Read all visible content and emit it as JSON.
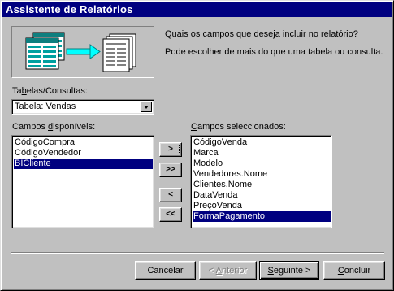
{
  "window": {
    "title": "Assistente de Relatórios"
  },
  "intro": {
    "line1": "Quais os campos que deseja incluir no relatório?",
    "line2": "Pode escolher de mais do que uma tabela ou consulta."
  },
  "tables": {
    "label_pre": "Ta",
    "label_accel": "b",
    "label_post": "elas/Consultas:",
    "selected": "Tabela: Vendas"
  },
  "available": {
    "label_pre": "Campos ",
    "label_accel": "d",
    "label_post": "isponíveis:",
    "items": [
      "CódigoCompra",
      "CódigoVendedor",
      "BICliente"
    ],
    "selected_index": 2
  },
  "selected_fields": {
    "label_pre": "",
    "label_accel": "C",
    "label_post": "ampos seleccionados:",
    "items": [
      "CódigoVenda",
      "Marca",
      "Modelo",
      "Vendedores.Nome",
      "Clientes.Nome",
      "DataVenda",
      "PreçoVenda",
      "FormaPagamento"
    ],
    "selected_index": 7
  },
  "move_buttons": {
    "add_one": ">",
    "add_all": ">>",
    "remove_one": "<",
    "remove_all": "<<"
  },
  "footer": {
    "cancel": "Cancelar",
    "back_pre": "< ",
    "back_accel": "A",
    "back_post": "nterior",
    "next_pre": "",
    "next_accel": "S",
    "next_post": "eguinte >",
    "finish_pre": "",
    "finish_accel": "C",
    "finish_post": "oncluir"
  },
  "colors": {
    "titlebar": "#000080",
    "selection": "#000080",
    "face": "#c0c0c0",
    "preview_table": "#0e7f7f"
  }
}
